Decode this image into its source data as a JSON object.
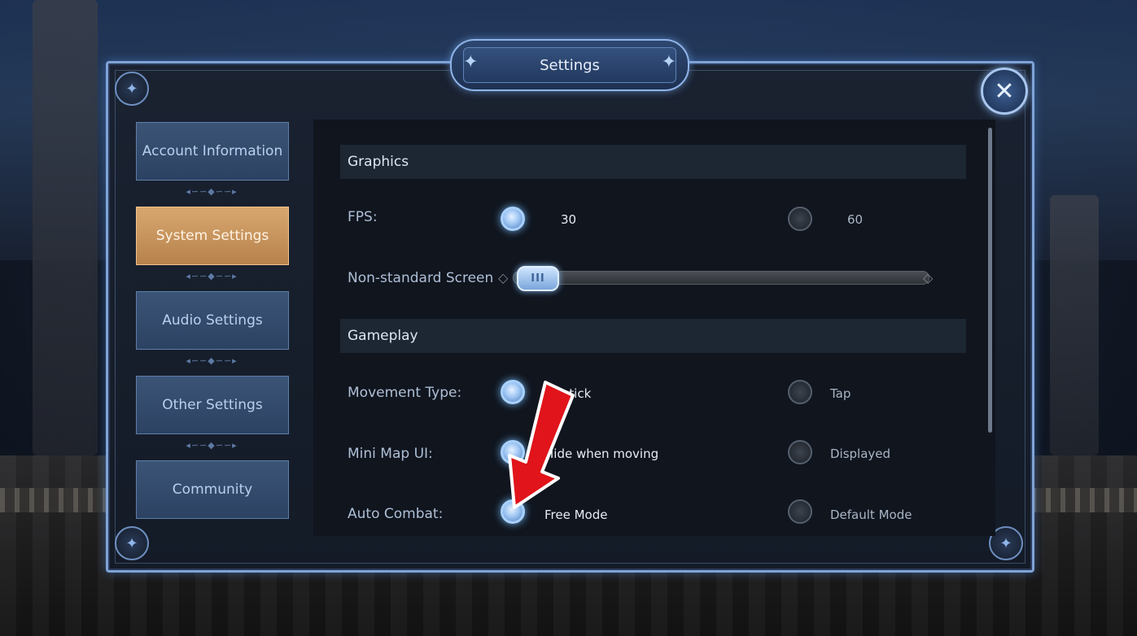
{
  "dialog": {
    "title": "Settings",
    "close_icon": "close-icon"
  },
  "sidebar": {
    "items": [
      {
        "label": "Account Information",
        "active": false
      },
      {
        "label": "System Settings",
        "active": true
      },
      {
        "label": "Audio Settings",
        "active": false
      },
      {
        "label": "Other Settings",
        "active": false
      },
      {
        "label": "Community",
        "active": false
      }
    ]
  },
  "graphics": {
    "header": "Graphics",
    "fps": {
      "label": "FPS:",
      "options": [
        "30",
        "60"
      ],
      "selected": "30"
    },
    "screen": {
      "label": "Non-standard Screen",
      "thumb": "III",
      "value": 0.0
    }
  },
  "gameplay": {
    "header": "Gameplay",
    "movement": {
      "label": "Movement Type:",
      "options": [
        "Joystick",
        "Tap"
      ],
      "selected": "Joystick"
    },
    "minimap": {
      "label": "Mini Map UI:",
      "options": [
        "Hide when moving",
        "Displayed"
      ],
      "selected": "Hide when moving"
    },
    "autocombat": {
      "label": "Auto Combat:",
      "options": [
        "Free Mode",
        "Default Mode"
      ],
      "selected": "Free Mode"
    }
  },
  "colors": {
    "accent": "#7fa3d6",
    "active_tab": "#d7a76f",
    "annotation_arrow": "#e0141a"
  }
}
